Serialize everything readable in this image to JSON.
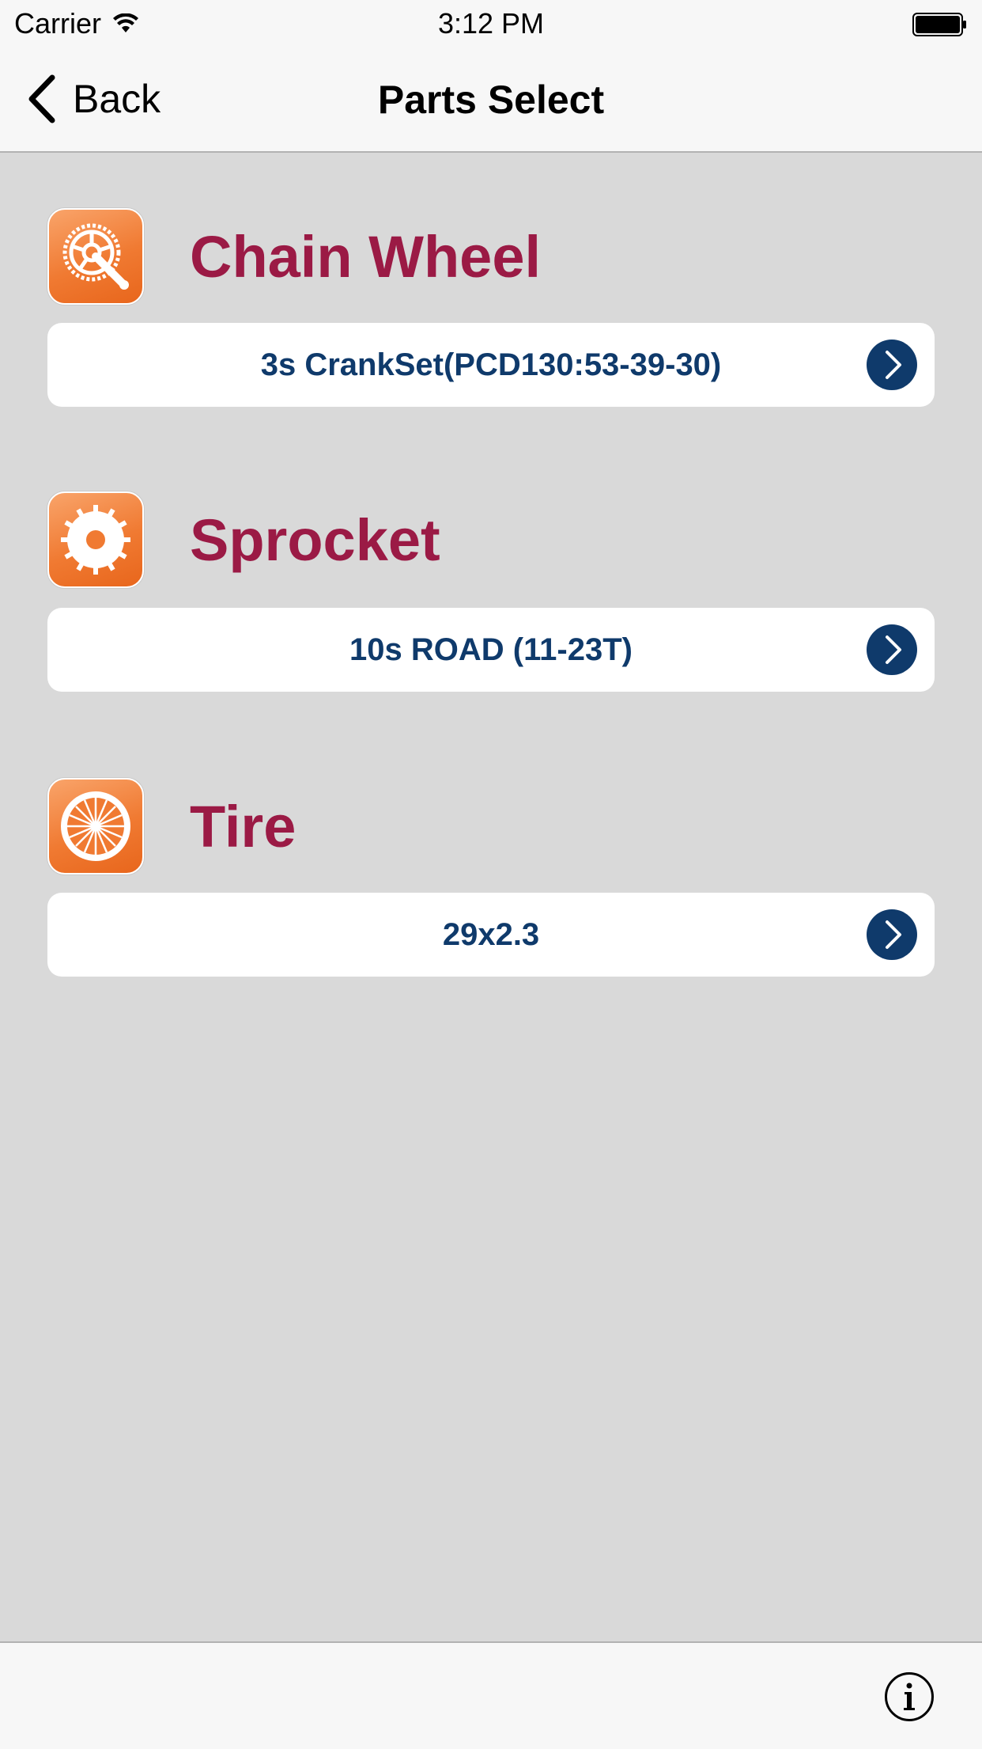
{
  "status_bar": {
    "carrier": "Carrier",
    "time": "3:12 PM"
  },
  "nav": {
    "back_label": "Back",
    "title": "Parts Select"
  },
  "sections": [
    {
      "title": "Chain Wheel",
      "value": "3s CrankSet(PCD130:53-39-30)",
      "icon": "chain-wheel-icon"
    },
    {
      "title": "Sprocket",
      "value": "10s ROAD (11-23T)",
      "icon": "sprocket-icon"
    },
    {
      "title": "Tire",
      "value": "29x2.3",
      "icon": "tire-icon"
    }
  ],
  "toolbar": {
    "info": "info-icon"
  },
  "colors": {
    "accent_title": "#9b1a45",
    "value_text": "#0f3a6b",
    "icon_orange": "#f07a32",
    "background": "#d9d9d9"
  }
}
